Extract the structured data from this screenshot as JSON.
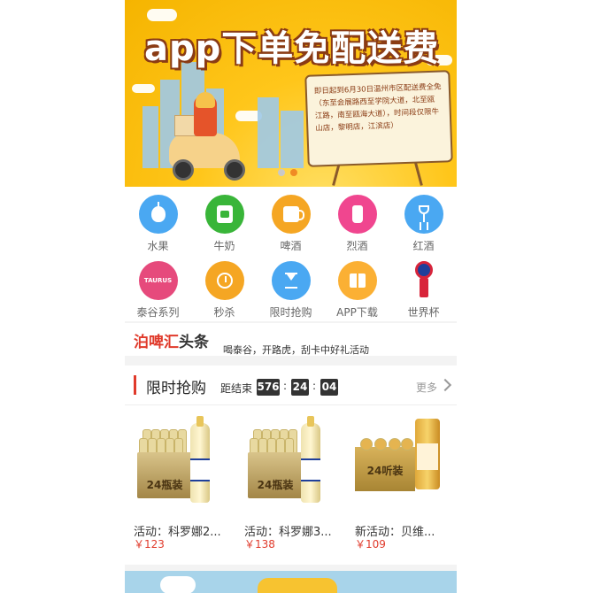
{
  "banner": {
    "title": "app下单免配送费",
    "notice": "即日起到6月30日温州市区配送费全免（东至会展路西至学院大道，北至瓯江路，南至瓯海大道），时间段仅限牛山店，黎明店，江滨店）",
    "active_slide": 2,
    "slide_count": 2
  },
  "categories": [
    {
      "label": "水果",
      "icon": "apple-icon",
      "color": "#4aa8f2"
    },
    {
      "label": "牛奶",
      "icon": "milk-icon",
      "color": "#39b539"
    },
    {
      "label": "啤酒",
      "icon": "beer-mug-icon",
      "color": "#f5a623"
    },
    {
      "label": "烈酒",
      "icon": "liquor-bottle-icon",
      "color": "#f0468f"
    },
    {
      "label": "红酒",
      "icon": "wine-glass-icon",
      "color": "#4aa8f2"
    },
    {
      "label": "泰谷系列",
      "icon": "taurus-logo-icon",
      "icon_text": "TAURUS",
      "color": "#e64a7c"
    },
    {
      "label": "秒杀",
      "icon": "alarm-clock-icon",
      "color": "#f5a623"
    },
    {
      "label": "限时抢购",
      "icon": "hourglass-icon",
      "color": "#4aa8f2"
    },
    {
      "label": "APP下载",
      "icon": "gift-icon",
      "color": "#fbb034"
    },
    {
      "label": "世界杯",
      "icon": "world-cup-trophy-icon",
      "color": "#d8243a"
    }
  ],
  "headline": {
    "brand_red": "泊啤汇",
    "brand_dark": "头条",
    "text": "喝泰谷，开路虎，刮卡中好礼活动"
  },
  "flash_sale": {
    "title": "限时抢购",
    "countdown_label": "距结束",
    "countdown": {
      "hours": "576",
      "minutes": "24",
      "seconds": "04"
    },
    "sep": ":",
    "more": "更多",
    "products": [
      {
        "name": "活动：科罗娜2...",
        "price": "￥123",
        "crate_text": "24瓶装"
      },
      {
        "name": "活动：科罗娜3...",
        "price": "￥138",
        "crate_text": "24瓶装"
      },
      {
        "name": "新活动：贝维...",
        "price": "￥109",
        "crate_text": "24听装"
      }
    ]
  },
  "colors": {
    "accent": "#e03a2b",
    "banner_yellow": "#ffc61a",
    "dot_active": "#f08a24"
  }
}
